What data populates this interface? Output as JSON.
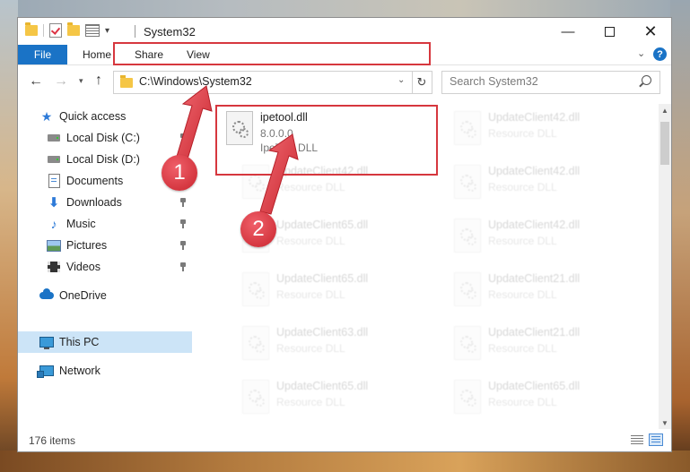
{
  "window": {
    "title": "System32",
    "minimize_glyph": "—",
    "close_glyph": "✕"
  },
  "ribbon": {
    "file_label": "File",
    "home_label": "Home",
    "share_label": "Share",
    "view_label": "View",
    "help_glyph": "?"
  },
  "navigation": {
    "address_path": "C:\\Windows\\System32",
    "search_placeholder": "Search System32"
  },
  "sidebar": {
    "items": [
      {
        "label": "Quick access"
      },
      {
        "label": "Local Disk (C:)"
      },
      {
        "label": "Local Disk (D:)"
      },
      {
        "label": "Documents"
      },
      {
        "label": "Downloads"
      },
      {
        "label": "Music"
      },
      {
        "label": "Pictures"
      },
      {
        "label": "Videos"
      },
      {
        "label": "OneDrive"
      },
      {
        "label": "This PC"
      },
      {
        "label": "Network"
      }
    ]
  },
  "files": {
    "highlighted": {
      "name": "ipetool.dll",
      "version": "8.0.0.0",
      "description": "IpeTool DLL"
    },
    "left_column": [
      {
        "name": "UpdateClient42.dll",
        "description": "Resource DLL"
      },
      {
        "name": "UpdateClient65.dll",
        "description": "Resource DLL"
      },
      {
        "name": "UpdateClient65.dll",
        "description": "Resource DLL"
      },
      {
        "name": "UpdateClient63.dll",
        "description": "Resource DLL"
      },
      {
        "name": "UpdateClient65.dll",
        "description": "Resource DLL"
      }
    ],
    "right_column": [
      {
        "name": "UpdateClient42.dll",
        "description": "Resource DLL"
      },
      {
        "name": "UpdateClient42.dll",
        "description": "Resource DLL"
      },
      {
        "name": "UpdateClient42.dll",
        "description": "Resource DLL"
      },
      {
        "name": "UpdateClient21.dll",
        "description": "Resource DLL"
      },
      {
        "name": "UpdateClient21.dll",
        "description": "Resource DLL"
      },
      {
        "name": "UpdateClient65.dll",
        "description": "Resource DLL"
      }
    ]
  },
  "status": {
    "item_count": "176 items"
  },
  "annotations": {
    "step1": "1",
    "step2": "2",
    "highlight_color": "#d6373e"
  },
  "icons": {
    "back": "arrow-left-icon",
    "forward": "arrow-right-icon",
    "up": "arrow-up-icon",
    "refresh": "refresh-icon",
    "search": "search-icon"
  }
}
